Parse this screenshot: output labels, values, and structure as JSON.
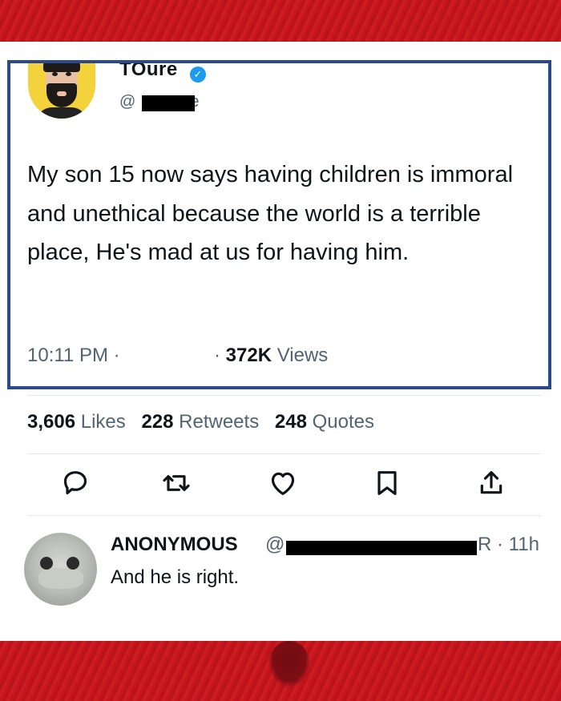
{
  "tweet": {
    "display_name": "TOure",
    "verified_icon": "check",
    "handle_prefix": "@",
    "handle_suffix": "e",
    "text": "My son 15 now says having children is immoral and unethical because the world is a terrible place, He's mad at us for having him.",
    "time": "10:11 PM ·",
    "views_dot": "·",
    "views_count": "372K",
    "views_label": "Views"
  },
  "stats": {
    "likes_count": "3,606",
    "likes_label": "Likes",
    "retweets_count": "228",
    "retweets_label": "Retweets",
    "quotes_count": "248",
    "quotes_label": "Quotes"
  },
  "actions": [
    "reply-icon",
    "retweet-icon",
    "like-icon",
    "bookmark-icon",
    "share-icon"
  ],
  "reply": {
    "name": "ANONYMOUS",
    "at": "@",
    "time_suffix": "R · 11h",
    "text": "And he is right."
  },
  "colors": {
    "frame_border": "#2b4a8c",
    "red_band": "#c8161b",
    "muted_text": "#536471",
    "verified_blue": "#1d9bf0"
  }
}
